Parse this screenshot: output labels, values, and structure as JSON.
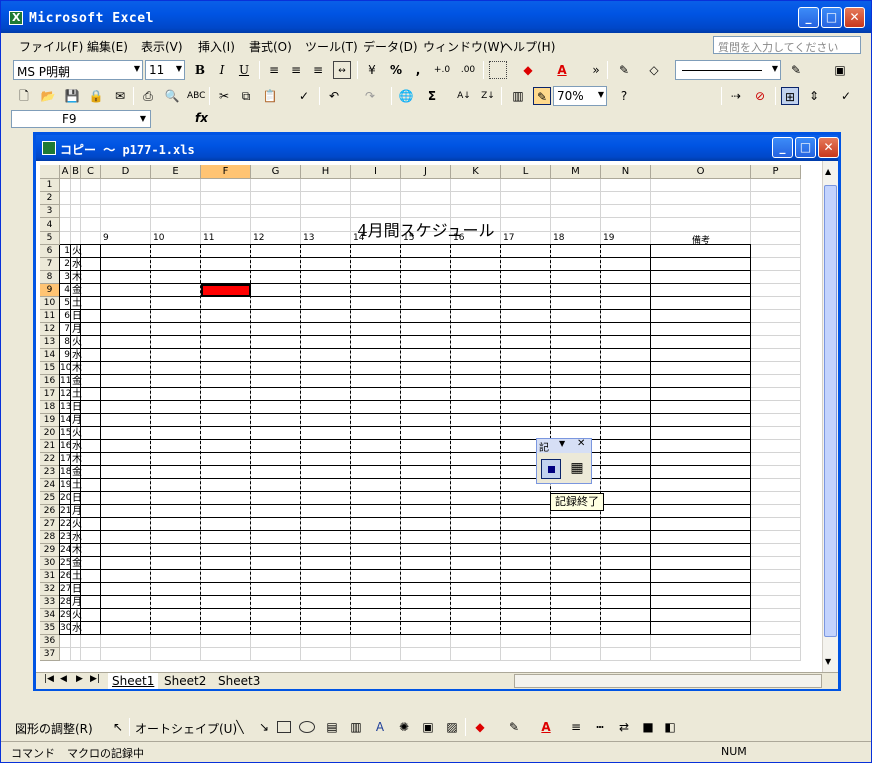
{
  "window": {
    "title": "Microsoft Excel"
  },
  "menu": {
    "items": [
      "ファイル(F)",
      "編集(E)",
      "表示(V)",
      "挿入(I)",
      "書式(O)",
      "ツール(T)",
      "データ(D)",
      "ウィンドウ(W)",
      "ヘルプ(H)"
    ],
    "help_placeholder": "質問を入力してください"
  },
  "format_toolbar": {
    "font": "MS P明朝",
    "size": "11",
    "bold": "B",
    "italic": "I",
    "underline": "U",
    "percent": "%",
    "comma": ",",
    "inc_decimal": "+.0 .00",
    "dec_decimal": ".00 →.0"
  },
  "standard_toolbar": {
    "zoom": "70%",
    "sigma": "Σ"
  },
  "formula_bar": {
    "name_box": "F9",
    "fx": "fx"
  },
  "workbook": {
    "title": "コピー 〜 p177-1.xls",
    "columns": [
      "A",
      "B",
      "C",
      "D",
      "E",
      "F",
      "G",
      "H",
      "I",
      "J",
      "K",
      "L",
      "M",
      "N",
      "O",
      "P"
    ],
    "sheet_title": "4月間スケジュール",
    "hours": [
      "9",
      "10",
      "11",
      "12",
      "13",
      "14",
      "15",
      "16",
      "17",
      "18",
      "19"
    ],
    "notes_header": "備考",
    "days": [
      {
        "n": "1",
        "d": "火"
      },
      {
        "n": "2",
        "d": "水"
      },
      {
        "n": "3",
        "d": "木"
      },
      {
        "n": "4",
        "d": "金"
      },
      {
        "n": "5",
        "d": "土"
      },
      {
        "n": "6",
        "d": "日"
      },
      {
        "n": "7",
        "d": "月"
      },
      {
        "n": "8",
        "d": "火"
      },
      {
        "n": "9",
        "d": "水"
      },
      {
        "n": "10",
        "d": "木"
      },
      {
        "n": "11",
        "d": "金"
      },
      {
        "n": "12",
        "d": "土"
      },
      {
        "n": "13",
        "d": "日"
      },
      {
        "n": "14",
        "d": "月"
      },
      {
        "n": "15",
        "d": "火"
      },
      {
        "n": "16",
        "d": "水"
      },
      {
        "n": "17",
        "d": "木"
      },
      {
        "n": "18",
        "d": "金"
      },
      {
        "n": "19",
        "d": "土"
      },
      {
        "n": "20",
        "d": "日"
      },
      {
        "n": "21",
        "d": "月"
      },
      {
        "n": "22",
        "d": "火"
      },
      {
        "n": "23",
        "d": "水"
      },
      {
        "n": "24",
        "d": "木"
      },
      {
        "n": "25",
        "d": "金"
      },
      {
        "n": "26",
        "d": "土"
      },
      {
        "n": "27",
        "d": "日"
      },
      {
        "n": "28",
        "d": "月"
      },
      {
        "n": "29",
        "d": "火"
      },
      {
        "n": "30",
        "d": "水"
      }
    ],
    "selected_cell": "F9",
    "highlight_color": "#ff0000",
    "sheets": [
      "Sheet1",
      "Sheet2",
      "Sheet3"
    ],
    "active_sheet": "Sheet1"
  },
  "macro_toolbar": {
    "title": "記",
    "tooltip": "記録終了"
  },
  "drawing_toolbar": {
    "draw": "図形の調整(R)",
    "autoshape": "オートシェイプ(U)"
  },
  "status": {
    "left": "コマンド",
    "message": "マクロの記録中",
    "num": "NUM"
  }
}
